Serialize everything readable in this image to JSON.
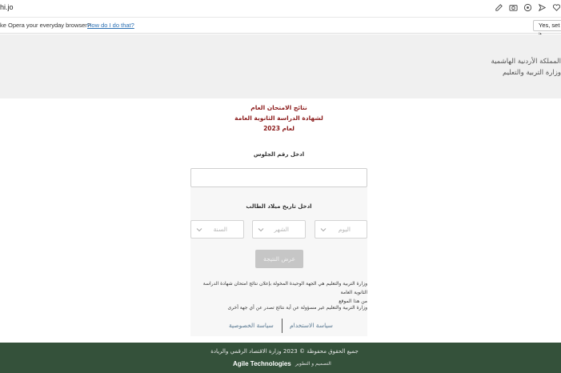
{
  "browser": {
    "url": "hi.jo",
    "icons": [
      "edit-icon",
      "camera-icon",
      "extension-icon",
      "send-icon",
      "heart-icon"
    ]
  },
  "infobar": {
    "message": "ke Opera your everyday browser?",
    "link": "How do I do that?",
    "button": "Yes, set it"
  },
  "header": {
    "line1": "المملكة الأردنية الهاشمية",
    "line2": "وزارة التربية والتعليم"
  },
  "form": {
    "title_line1": "نتائج الامتحان العام",
    "title_line2": "لشهادة الدراسة الثانوية العامة",
    "title_line3": "لعام 2023",
    "seat_label": "ادخل رقم الجلوس",
    "dob_label": "ادخل تاريخ ميلاد الطالب",
    "day_placeholder": "اليوم",
    "month_placeholder": "الشهر",
    "year_placeholder": "السنة",
    "submit": "عرض النتيجة",
    "note1_line1": "وزارة التربية والتعليم هي الجهة الوحيدة المخولة بإعلان نتائج امتحان شهادة الدراسة الثانوية العامة",
    "note1_line2": "من هذا الموقع",
    "note2": "وزارة التربية والتعليم غير مسؤولة عن أية نتائج تصدر عن أي جهة أخرى"
  },
  "links": {
    "terms": "سياسة الاستخدام",
    "privacy": "سياسة الخصوصية"
  },
  "footer": {
    "copyright": "جميع الحقوق محفوظة © 2023 وزارة الاقتصاد الرقمي والريادة",
    "brand": "Agile Technologies",
    "credit": "التصميم و التطوير"
  }
}
